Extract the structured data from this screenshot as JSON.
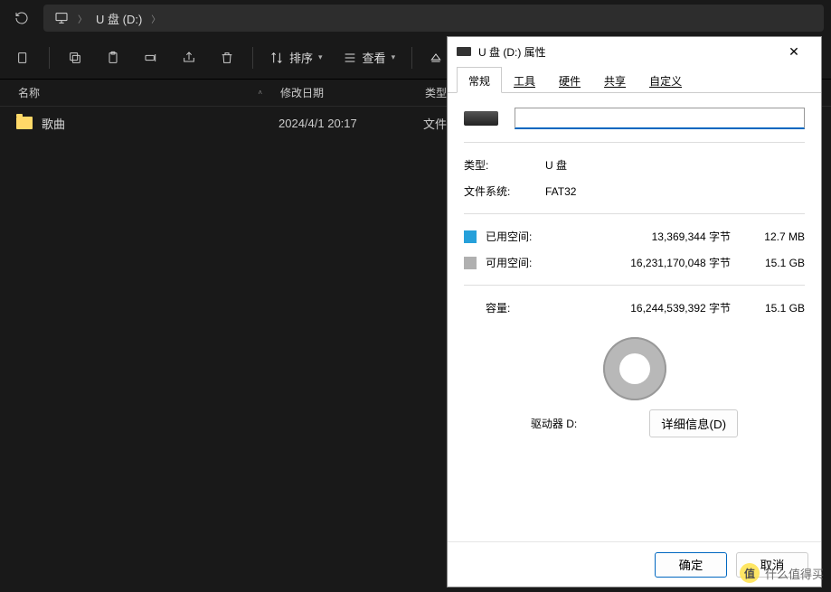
{
  "addressbar": {
    "drive_label": "U 盘 (D:)"
  },
  "toolbar": {
    "sort": "排序",
    "view": "查看",
    "eject": "弹出"
  },
  "columns": {
    "name": "名称",
    "date": "修改日期",
    "type": "类型"
  },
  "files": [
    {
      "name": "歌曲",
      "date": "2024/4/1 20:17",
      "type": "文件"
    }
  ],
  "dialog": {
    "title": "U 盘 (D:) 属性",
    "tabs": [
      "常规",
      "工具",
      "硬件",
      "共享",
      "自定义"
    ],
    "type_label": "类型:",
    "type_value": "U 盘",
    "fs_label": "文件系统:",
    "fs_value": "FAT32",
    "used_label": "已用空间:",
    "used_bytes": "13,369,344 字节",
    "used_hr": "12.7 MB",
    "free_label": "可用空间:",
    "free_bytes": "16,231,170,048 字节",
    "free_hr": "15.1 GB",
    "cap_label": "容量:",
    "cap_bytes": "16,244,539,392 字节",
    "cap_hr": "15.1 GB",
    "drive_text": "驱动器 D:",
    "details_btn": "详细信息(D)",
    "ok": "确定",
    "cancel": "取消"
  },
  "watermark": "什么值得买",
  "chart_data": {
    "type": "pie",
    "title": "驱动器 D:",
    "series": [
      {
        "name": "已用空间",
        "value": 13369344,
        "human": "12.7 MB",
        "color": "#26a0da"
      },
      {
        "name": "可用空间",
        "value": 16231170048,
        "human": "15.1 GB",
        "color": "#b0b0b0"
      }
    ],
    "total": {
      "name": "容量",
      "value": 16244539392,
      "human": "15.1 GB"
    }
  }
}
